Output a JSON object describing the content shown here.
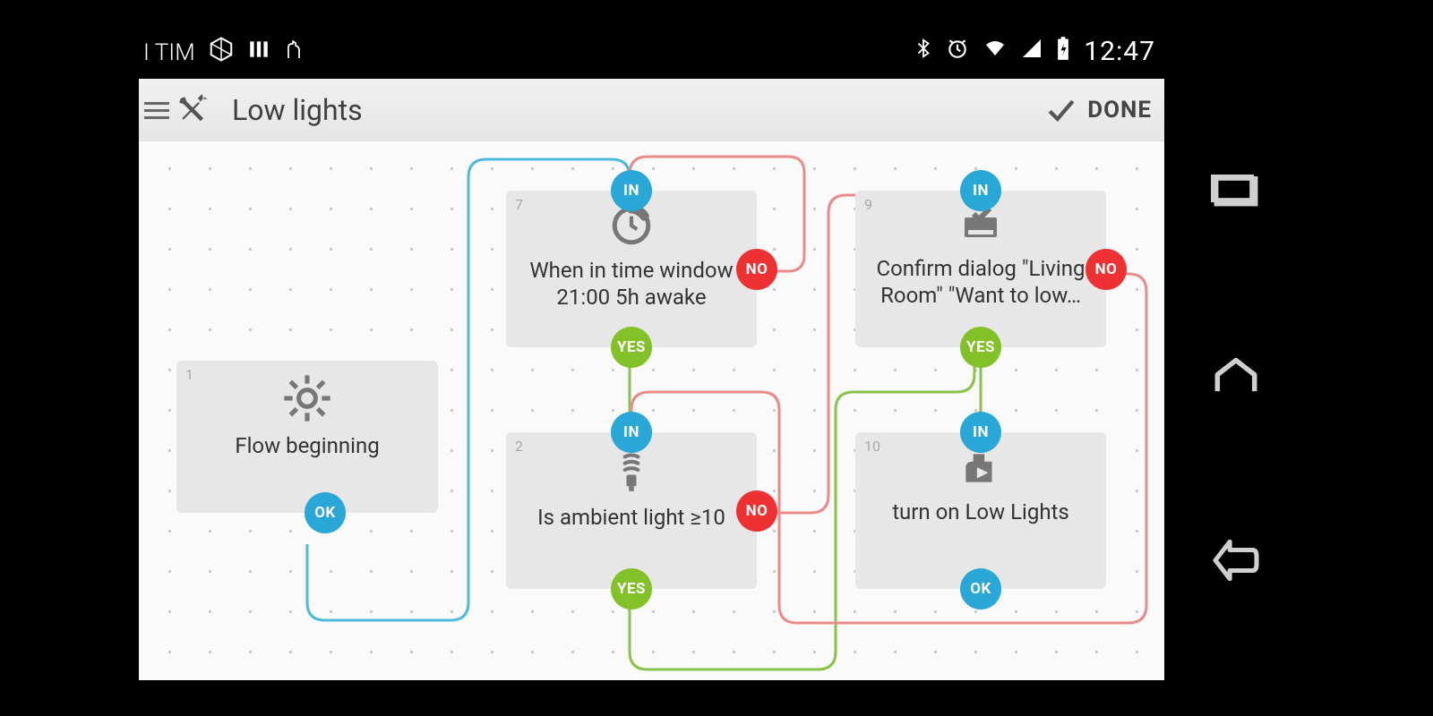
{
  "statusbar": {
    "carrier": "I TIM",
    "time": "12:47"
  },
  "header": {
    "title": "Low lights",
    "done": "DONE"
  },
  "ports": {
    "in": "IN",
    "yes": "YES",
    "no": "NO",
    "ok": "OK"
  },
  "nodes": {
    "n1": {
      "num": "1",
      "label": "Flow beginning"
    },
    "n7": {
      "num": "7",
      "label": "When in time window 21:00 5h awake"
    },
    "n2": {
      "num": "2",
      "label": "Is ambient light ≥10"
    },
    "n9": {
      "num": "9",
      "label": "Confirm dialog \"Living Room\" \"Want to low…"
    },
    "n10": {
      "num": "10",
      "label": "turn on Low Lights"
    }
  },
  "colors": {
    "in": "#29a7d6",
    "yes": "#82c127",
    "no": "#ee3233",
    "okwire": "#4fb9de",
    "yeswire": "#8bc34a",
    "nowire": "#e57373"
  }
}
